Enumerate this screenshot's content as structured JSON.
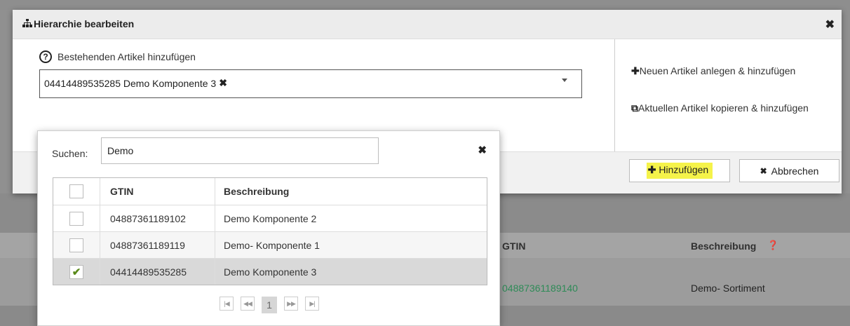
{
  "modal": {
    "title": "Hierarchie bearbeiten",
    "field_label": "Bestehenden Artikel hinzufügen",
    "selected_tag": "04414489535285 Demo Komponente 3",
    "side_actions": [
      {
        "icon": "plus-icon",
        "label": "Neuen Artikel anlegen & hinzufügen"
      },
      {
        "icon": "copy-icon",
        "label": "Aktuellen Artikel kopieren & hinzufügen"
      }
    ],
    "add_button": "Hinzufügen",
    "cancel_button": "Abbrechen"
  },
  "popup": {
    "search_label": "Suchen:",
    "search_value": "Demo",
    "columns": {
      "gtin": "GTIN",
      "desc": "Beschreibung"
    },
    "rows": [
      {
        "gtin": "04887361189102",
        "desc": "Demo Komponente 2",
        "checked": false
      },
      {
        "gtin": "04887361189119",
        "desc": "Demo- Komponente 1",
        "checked": false
      },
      {
        "gtin": "04414489535285",
        "desc": "Demo Komponente 3",
        "checked": true
      }
    ],
    "page": "1"
  },
  "background": {
    "col_gtin": "GTIN",
    "col_desc": "Beschreibung",
    "row_gtin": "04887361189140",
    "row_desc": "Demo- Sortiment"
  },
  "colors": {
    "highlight": "#f5f34a",
    "check": "#5a8a1a",
    "link_green": "#2e8b57"
  }
}
